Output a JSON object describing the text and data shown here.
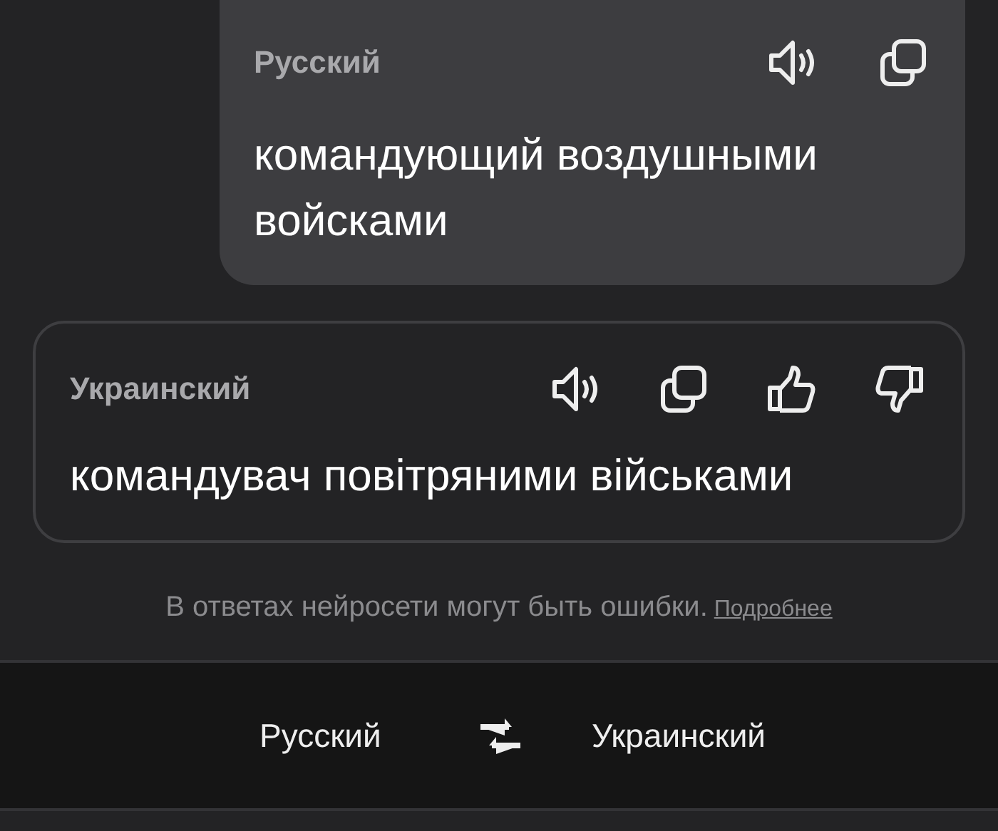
{
  "source": {
    "language": "Русский",
    "text": "командующий воздушными войсками",
    "actions": [
      {
        "kind": "speak"
      },
      {
        "kind": "copy"
      }
    ]
  },
  "translation": {
    "language": "Украинский",
    "text": "командувач повітряними військами",
    "actions": [
      {
        "kind": "speak"
      },
      {
        "kind": "copy"
      },
      {
        "kind": "like"
      },
      {
        "kind": "dislike"
      }
    ]
  },
  "disclaimer": {
    "text": "В ответах нейросети могут быть ошибки.",
    "link": "Подробнее"
  },
  "language_bar": {
    "source_language": "Русский",
    "target_language": "Украинский"
  }
}
